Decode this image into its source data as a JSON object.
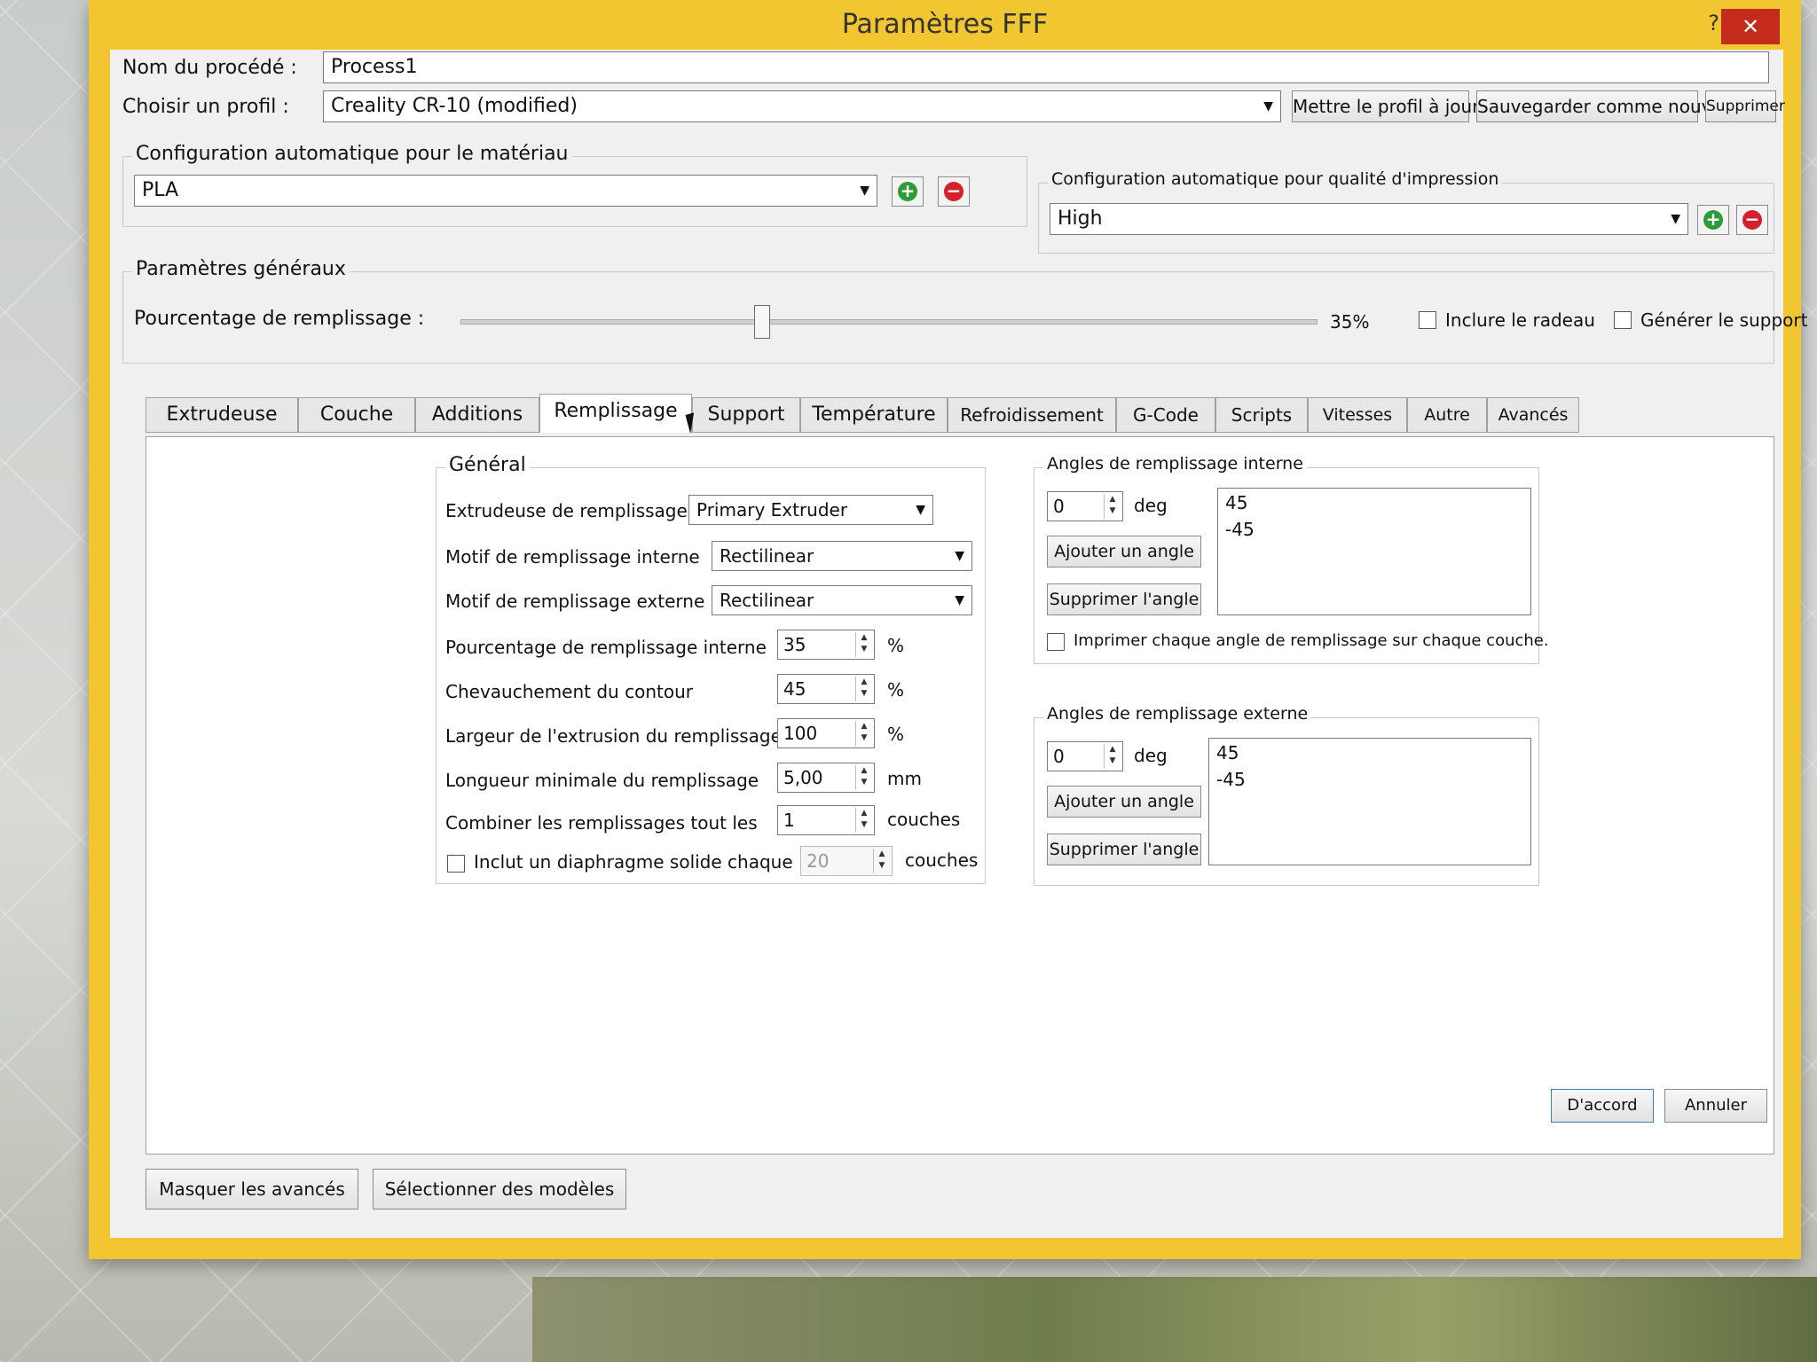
{
  "window": {
    "title": "Paramètres FFF",
    "help": "?",
    "close": "✕"
  },
  "process": {
    "label": "Nom du procédé :",
    "value": "Process1"
  },
  "profile": {
    "label": "Choisir un profil :",
    "value": "Creality CR-10 (modified)",
    "update": "Mettre le profil à jour",
    "save_new": "Sauvegarder comme nouveau",
    "delete": "Supprimer"
  },
  "material": {
    "title": "Configuration automatique pour le matériau",
    "value": "PLA"
  },
  "quality": {
    "title": "Configuration automatique pour qualité d'impression",
    "value": "High"
  },
  "general_params": {
    "title": "Paramètres généraux",
    "infill_label": "Pourcentage de remplissage :",
    "infill_value_text": "35%",
    "infill_value": 35,
    "raft_label": "Inclure le radeau",
    "support_label": "Générer le support"
  },
  "tabs": [
    {
      "label": "Extrudeuse"
    },
    {
      "label": "Couche"
    },
    {
      "label": "Additions"
    },
    {
      "label": "Remplissage"
    },
    {
      "label": "Support"
    },
    {
      "label": "Température"
    },
    {
      "label": "Refroidissement"
    },
    {
      "label": "G-Code"
    },
    {
      "label": "Scripts"
    },
    {
      "label": "Vitesses"
    },
    {
      "label": "Autre"
    },
    {
      "label": "Avancés"
    }
  ],
  "infill_general": {
    "title": "Général",
    "extruder_label": "Extrudeuse de remplissage",
    "extruder_value": "Primary Extruder",
    "internal_pattern_label": "Motif de remplissage interne",
    "internal_pattern_value": "Rectilinear",
    "external_pattern_label": "Motif de remplissage externe",
    "external_pattern_value": "Rectilinear",
    "internal_pct_label": "Pourcentage de remplissage interne",
    "internal_pct_value": "35",
    "overlap_label": "Chevauchement du contour",
    "overlap_value": "45",
    "extrusion_width_label": "Largeur de l'extrusion du remplissage",
    "extrusion_width_value": "100",
    "min_length_label": "Longueur minimale du remplissage",
    "min_length_value": "5,00",
    "combine_label": "Combiner les remplissages tout les",
    "combine_value": "1",
    "diaphragm_label": "Inclut un diaphragme solide chaque",
    "diaphragm_value": "20",
    "unit_pct": "%",
    "unit_mm": "mm",
    "unit_layers": "couches"
  },
  "internal_angles": {
    "title": "Angles de remplissage interne",
    "input_value": "0",
    "unit": "deg",
    "add": "Ajouter un angle",
    "remove": "Supprimer l'angle",
    "list": [
      "45",
      "-45"
    ],
    "print_each_label": "Imprimer chaque angle de remplissage sur chaque couche."
  },
  "external_angles": {
    "title": "Angles de remplissage externe",
    "input_value": "0",
    "unit": "deg",
    "add": "Ajouter un angle",
    "remove": "Supprimer l'angle",
    "list": [
      "45",
      "-45"
    ]
  },
  "footer": {
    "ok": "D'accord",
    "cancel": "Annuler",
    "hide_advanced": "Masquer les avancés",
    "select_models": "Sélectionner des modèles"
  },
  "colors": {
    "titlebar": "#f1c630",
    "close": "#c42b1c",
    "add": "#2e9a3a",
    "remove": "#d41f2c"
  }
}
